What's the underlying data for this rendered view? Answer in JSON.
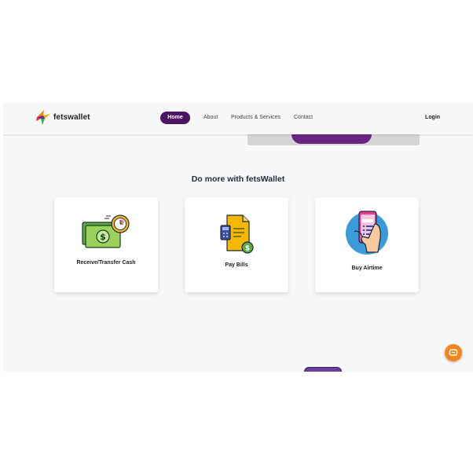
{
  "brand": {
    "name": "fetswallet"
  },
  "nav": {
    "home": "Home",
    "about": "About",
    "products": "Products & Services",
    "contact": "Contact",
    "login": "Login"
  },
  "section": {
    "title": "Do more with fetsWallet"
  },
  "cards": [
    {
      "label": "Receive/Transfer Cash",
      "icon": "cash-transfer-icon"
    },
    {
      "label": "Pay Bills",
      "icon": "bill-icon"
    },
    {
      "label": "Buy Airtime",
      "icon": "phone-airtime-icon"
    }
  ],
  "colors": {
    "brand_purple": "#4b1563",
    "chat_orange": "#f5851f",
    "page_bg": "#f7f8fa"
  }
}
